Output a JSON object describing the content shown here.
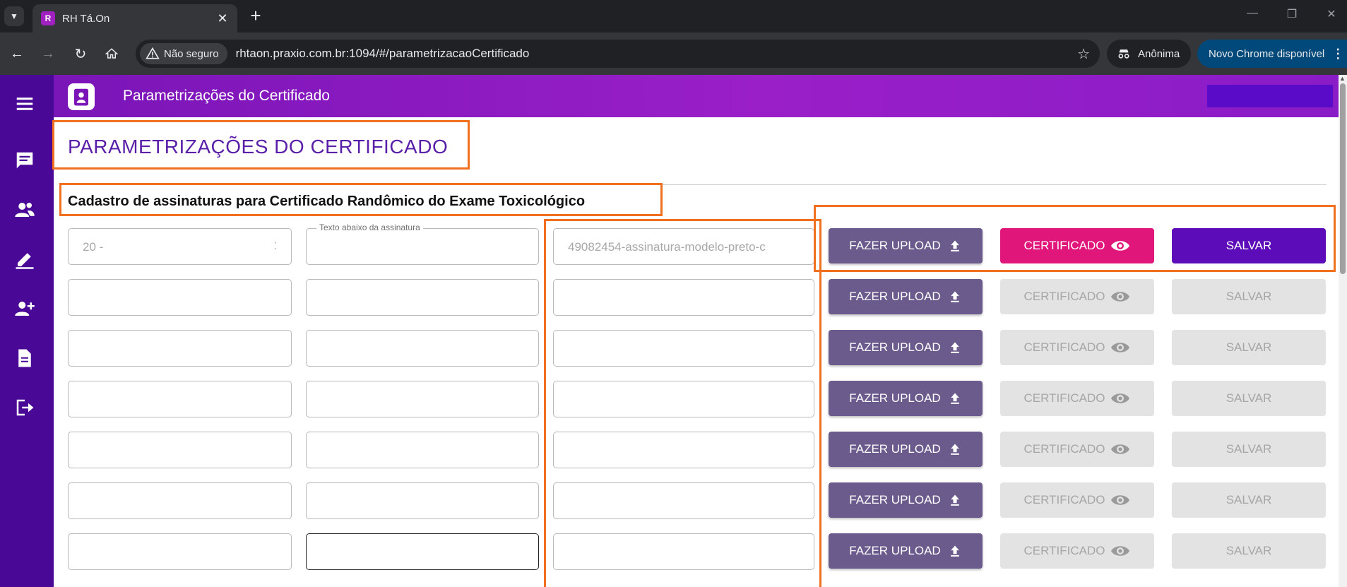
{
  "browser": {
    "tab_title": "RH Tá.On",
    "tab_favicon_letter": "R",
    "new_tab_symbol": "+",
    "security_label": "Não seguro",
    "url": "rhtaon.praxio.com.br:1094/#/parametrizacaoCertificado",
    "incognito_label": "Anônima",
    "update_label": "Novo Chrome disponível"
  },
  "app": {
    "header_title": "Parametrizações do Certificado",
    "page_title": "PARAMETRIZAÇÕES DO CERTIFICADO",
    "subtitle": "Cadastro de assinaturas para Certificado Randômico do Exame Toxicológico",
    "sidebar_icons": [
      "menu-icon",
      "chat-icon",
      "users-icon",
      "edit-icon",
      "add-user-icon",
      "document-icon",
      "logout-icon"
    ]
  },
  "form": {
    "field2_label": "Texto abaixo da assinatura",
    "upload_label": "FAZER UPLOAD",
    "certificate_label": "CERTIFICADO",
    "save_label": "SALVAR",
    "rows": [
      {
        "select_value": "20 -",
        "text_value": "",
        "file_value": "49082454-assinatura-modelo-preto-c",
        "active": true
      },
      {
        "select_value": "",
        "text_value": "",
        "file_value": "",
        "active": false
      },
      {
        "select_value": "",
        "text_value": "",
        "file_value": "",
        "active": false
      },
      {
        "select_value": "",
        "text_value": "",
        "file_value": "",
        "active": false
      },
      {
        "select_value": "",
        "text_value": "",
        "file_value": "",
        "active": false
      },
      {
        "select_value": "",
        "text_value": "",
        "file_value": "",
        "active": false
      },
      {
        "select_value": "",
        "text_value": "",
        "file_value": "",
        "active": false
      }
    ]
  },
  "colors": {
    "sidebar": "#4a0896",
    "header": "#8a1cc8",
    "title": "#5a1fa8",
    "upload_button": "#6b5a8c",
    "certificate_active": "#e0167a",
    "save_active": "#5c0cb8",
    "annotation": "#f07020"
  }
}
